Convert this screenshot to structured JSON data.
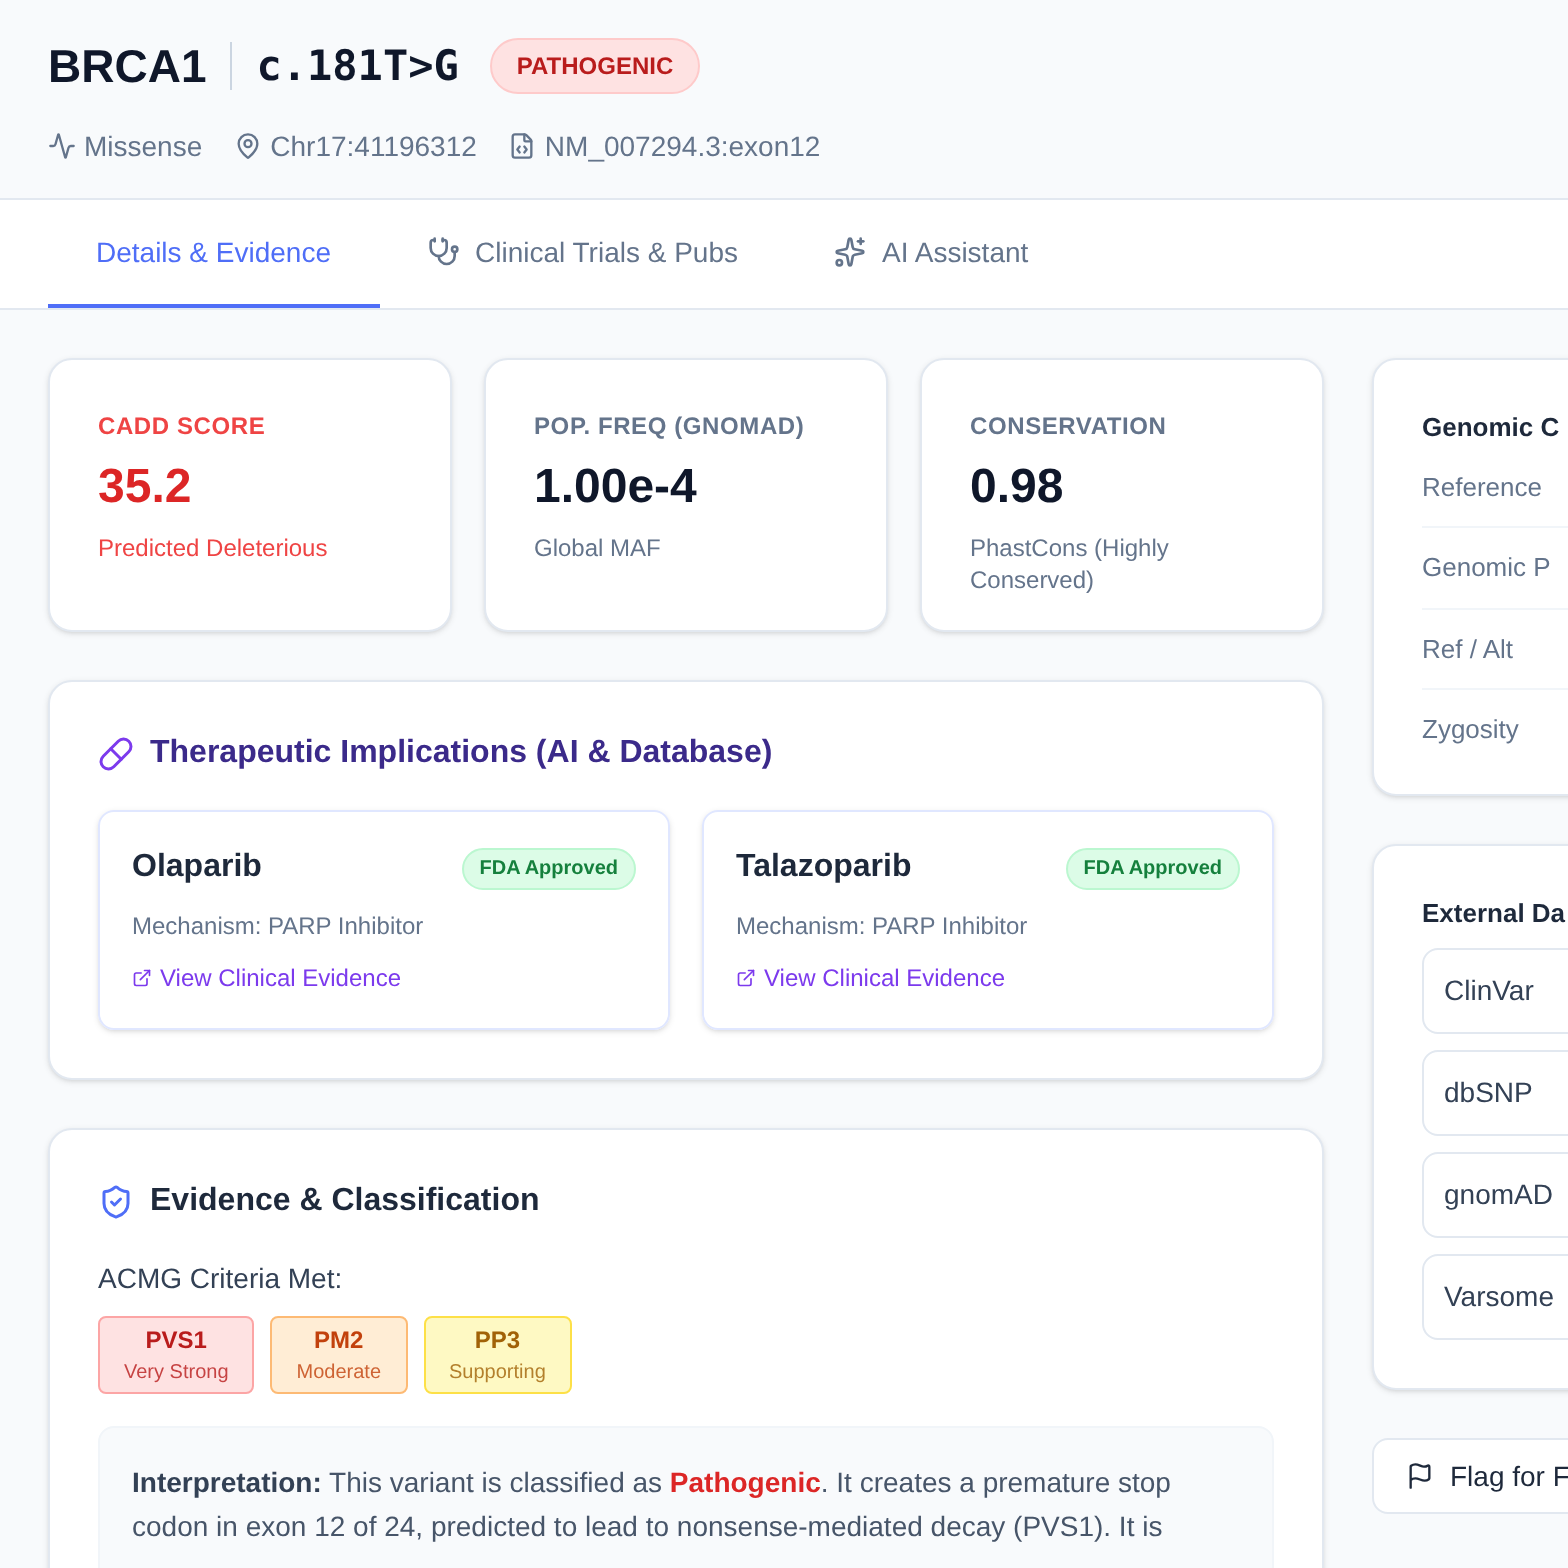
{
  "header": {
    "gene": "BRCA1",
    "variant": "c.181T>G",
    "classification": "PATHOGENIC",
    "meta": [
      {
        "kind": "type",
        "text": "Missense"
      },
      {
        "kind": "location",
        "text": "Chr17:41196312"
      },
      {
        "kind": "transcript",
        "text": "NM_007294.3:exon12"
      }
    ]
  },
  "tabs": [
    {
      "label": "Details & Evidence",
      "kind": "details",
      "selected": true
    },
    {
      "label": "Clinical Trials & Pubs",
      "kind": "trials",
      "selected": false
    },
    {
      "label": "AI Assistant",
      "kind": "ai",
      "selected": false
    }
  ],
  "stats": [
    {
      "label": "CADD SCORE",
      "value": "35.2",
      "note": "Predicted Deleterious",
      "alert": true
    },
    {
      "label": "POP. FREQ (GNOMAD)",
      "value": "1.00e-4",
      "note": "Global MAF",
      "alert": false
    },
    {
      "label": "CONSERVATION",
      "value": "0.98",
      "note": "PhastCons (Highly Conserved)",
      "alert": false
    }
  ],
  "therapeutics": {
    "title": "Therapeutic Implications (AI & Database)",
    "drugs": [
      {
        "name": "Olaparib",
        "badge": "FDA Approved",
        "mechanism": "Mechanism: PARP Inhibitor",
        "link": "View Clinical Evidence"
      },
      {
        "name": "Talazoparib",
        "badge": "FDA Approved",
        "mechanism": "Mechanism: PARP Inhibitor",
        "link": "View Clinical Evidence"
      }
    ]
  },
  "evidence": {
    "title": "Evidence & Classification",
    "criteria_label": "ACMG Criteria Met:",
    "criteria": [
      {
        "code": "PVS1",
        "strength": "Very Strong",
        "color": "#fee2e2"
      },
      {
        "code": "PM2",
        "strength": "Moderate",
        "color": "#ffedd5"
      },
      {
        "code": "PP3",
        "strength": "Supporting",
        "color": "#fef9c3"
      }
    ],
    "interpretation": [
      {
        "kind": "label",
        "text": "Interpretation:"
      },
      {
        "kind": "plain",
        "text": " This variant is classified as "
      },
      {
        "kind": "highlight",
        "text": "Pathogenic"
      },
      {
        "kind": "plain",
        "text": ". It creates a premature stop codon in exon 12 of 24, predicted to lead to nonsense-mediated decay (PVS1). It is"
      }
    ]
  },
  "genomic": {
    "title": "Genomic C",
    "rows": [
      "Reference",
      "Genomic P",
      "Ref / Alt",
      "Zygosity"
    ]
  },
  "external": {
    "title": "External Da",
    "links": [
      "ClinVar",
      "dbSNP",
      "gnomAD",
      "Varsome"
    ]
  },
  "actions": [
    {
      "label": "Flag for F"
    }
  ]
}
